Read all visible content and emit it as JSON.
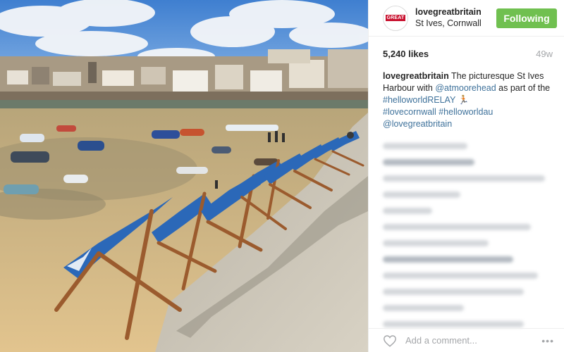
{
  "photo": {
    "description_icon": "photo-harbour"
  },
  "header": {
    "avatar_text": "GREAT",
    "username": "lovegreatbritain",
    "location": "St Ives, Cornwall",
    "follow_label": "Following"
  },
  "stats": {
    "likes": "5,240 likes",
    "time": "49w"
  },
  "caption": {
    "username": "lovegreatbritain",
    "text_1": " The picturesque St Ives Harbour with ",
    "mention_1": "@atmoorehead",
    "text_2": " as part of the ",
    "hashtag_1": "#helloworldRELAY",
    "emoji": " 🏃🏼",
    "hashtag_2": "#lovecornwall",
    "hashtag_3": "#helloworldau",
    "mention_2": "@lovegreatbritain"
  },
  "footer": {
    "comment_placeholder": "Add a comment...",
    "more_label": "•••"
  },
  "colors": {
    "follow_button": "#70c050",
    "link": "#3f729b",
    "meta_gray": "#a5a7aa"
  }
}
